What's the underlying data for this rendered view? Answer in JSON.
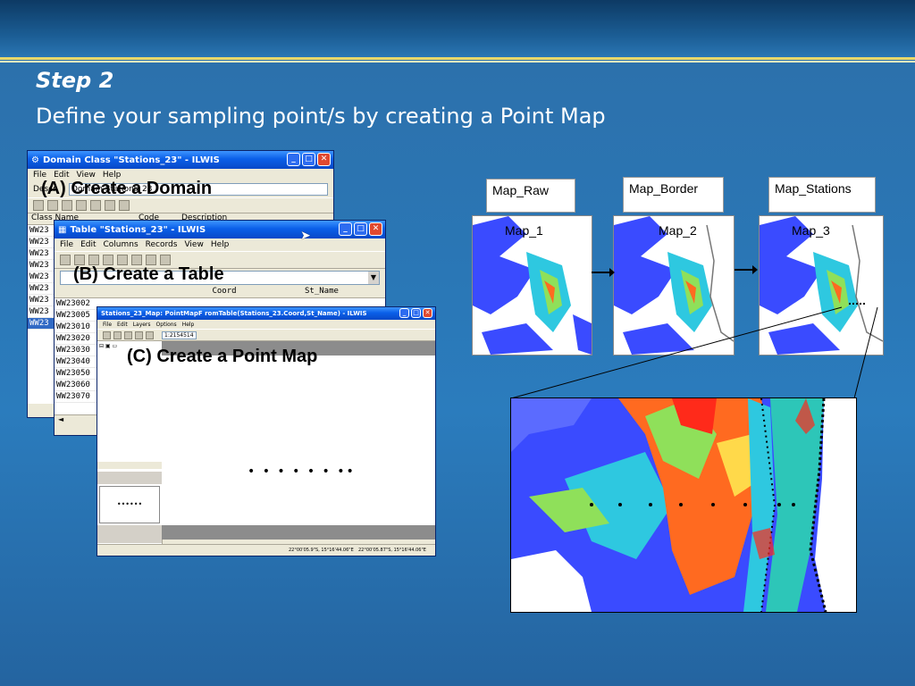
{
  "slide": {
    "step": "Step 2",
    "title": "Define your sampling point/s by creating a Point Map"
  },
  "window_domain": {
    "title": "Domain Class \"Stations_23\" - ILWIS",
    "menus": [
      "File",
      "Edit",
      "View",
      "Help"
    ],
    "field_label": "Descr",
    "field_value": "Domain Stations_23",
    "columns": [
      "Class Name",
      "Code",
      "Description"
    ],
    "rows": [
      "WW23",
      "WW23",
      "WW23",
      "WW23",
      "WW23",
      "WW23",
      "WW23",
      "WW23",
      "WW23"
    ]
  },
  "window_table": {
    "title": "Table \"Stations_23\" - ILWIS",
    "menus": [
      "File",
      "Edit",
      "Columns",
      "Records",
      "View",
      "Help"
    ],
    "col_coord": "Coord",
    "col_stname": "St_Name",
    "rows": [
      "WW23002",
      "WW23005",
      "WW23010",
      "WW23020",
      "WW23030",
      "WW23040",
      "WW23050",
      "WW23060",
      "WW23070"
    ]
  },
  "window_map": {
    "title": "Stations_23_Map: PointMapF romTable(Stations_23.Coord,St_Name) - ILWIS",
    "menus": [
      "File",
      "Edit",
      "Layers",
      "Options",
      "Help"
    ],
    "scale": "1:2154514",
    "coord1": "22°00'05.9\"S, 15°16'44.06\"E",
    "coord2": "22°00'05.87\"S, 15°16'44.06\"E",
    "points": "• • • • • • ••"
  },
  "labels": {
    "a": "(A) Create a Domain",
    "b": "(B) Create a Table",
    "c": "(C) Create a Point Map"
  },
  "maps": [
    {
      "name": "Map_Raw",
      "label": "Map_1"
    },
    {
      "name": "Map_Border",
      "label": "Map_2"
    },
    {
      "name": "Map_Stations",
      "label": "Map_3"
    }
  ],
  "colors": {
    "xp_title": "#0a5fe8",
    "gold": "#d4c84a",
    "map_blue": "#3a4bff"
  }
}
